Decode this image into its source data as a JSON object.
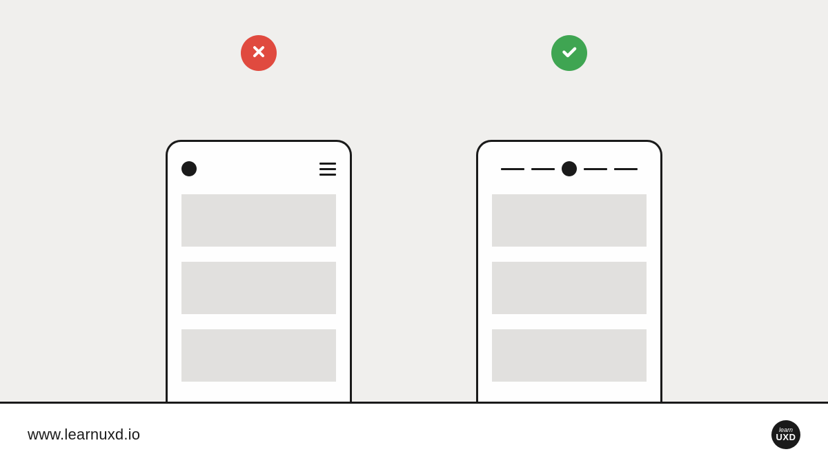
{
  "footer": {
    "url": "www.learnuxd.io",
    "logo": {
      "line1": "learn",
      "line2": "UXD"
    }
  },
  "badges": {
    "wrong_icon": "cross-icon",
    "right_icon": "check-icon"
  },
  "colors": {
    "wrong": "#e04a3f",
    "right": "#3fa552",
    "stroke": "#1a1a1a",
    "placeholder": "#e1e0de",
    "background": "#f0efed"
  },
  "diagram": {
    "left": {
      "label": "hamburger-menu-pattern",
      "header_style": "logo-left-hamburger-right",
      "content_blocks": 3
    },
    "right": {
      "label": "visible-nav-pattern",
      "header_style": "centered-logo-with-nav-dashes",
      "nav_items": 4,
      "content_blocks": 3
    }
  }
}
